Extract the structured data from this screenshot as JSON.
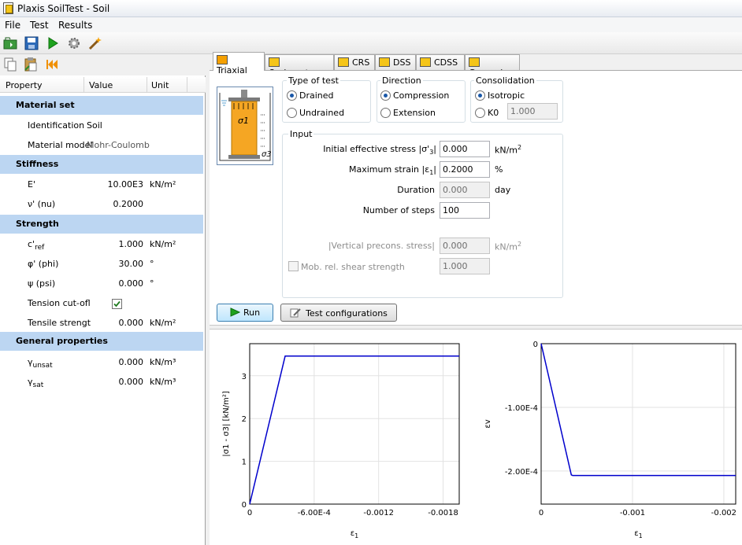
{
  "window": {
    "title": "Plaxis SoilTest - Soil"
  },
  "menu": [
    "File",
    "Test",
    "Results"
  ],
  "toolbar_icons": [
    "open-icon",
    "save-icon",
    "run-icon",
    "settings-icon",
    "wizard-icon"
  ],
  "left_toolbar_icons": [
    "copy-icon",
    "paste-icon",
    "rewind-icon"
  ],
  "properties": {
    "headers": {
      "property": "Property",
      "value": "Value",
      "unit": "Unit"
    },
    "material_set": {
      "title": "Material set",
      "identification": {
        "label": "Identification",
        "value": "Soil"
      },
      "material_model": {
        "label": "Material model",
        "value": "Mohr-Coulomb"
      }
    },
    "stiffness": {
      "title": "Stiffness",
      "E": {
        "label": "E'",
        "value": "10.00E3",
        "unit": "kN/m²"
      },
      "nu": {
        "label": "ν' (nu)",
        "value": "0.2000"
      }
    },
    "strength": {
      "title": "Strength",
      "c_ref": {
        "label_main": "c'",
        "label_sub": "ref",
        "value": "1.000",
        "unit": "kN/m²"
      },
      "phi": {
        "label": "φ' (phi)",
        "value": "30.00",
        "unit": "°"
      },
      "psi": {
        "label": "ψ (psi)",
        "value": "0.000",
        "unit": "°"
      },
      "tension_cutoff": {
        "label": "Tension cut-ofl",
        "checked": true
      },
      "tensile_strength": {
        "label": "Tensile strengt",
        "value": "0.000",
        "unit": "kN/m²"
      }
    },
    "general": {
      "title": "General properties",
      "gamma_unsat": {
        "label_main": "γ",
        "label_sub": "unsat",
        "value": "0.000",
        "unit": "kN/m³"
      },
      "gamma_sat": {
        "label_main": "γ",
        "label_sub": "sat",
        "value": "0.000",
        "unit": "kN/m³"
      }
    }
  },
  "tabs": [
    {
      "label": "Triaxial",
      "active": true
    },
    {
      "label": "Oedometer"
    },
    {
      "label": "CRS"
    },
    {
      "label": "DSS"
    },
    {
      "label": "CDSS"
    },
    {
      "label": "General"
    }
  ],
  "diagram": {
    "sigma1": "σ1",
    "sigma3": "σ3"
  },
  "type_of_test": {
    "title": "Type of test",
    "options": [
      "Drained",
      "Undrained"
    ],
    "selected": "Drained"
  },
  "direction": {
    "title": "Direction",
    "options": [
      "Compression",
      "Extension"
    ],
    "selected": "Compression"
  },
  "consolidation": {
    "title": "Consolidation",
    "options": [
      "Isotropic",
      "K0"
    ],
    "selected": "Isotropic",
    "k0_value": "1.000"
  },
  "input": {
    "title": "Input",
    "initial_stress": {
      "label_pre": "Initial effective stress |σ'",
      "label_sub": "3",
      "label_post": "|",
      "value": "0.000",
      "unit": "kN/m",
      "unit_sup": "2"
    },
    "max_strain": {
      "label_pre": "Maximum strain |ε",
      "label_sub": "1",
      "label_post": "|",
      "value": "0.2000",
      "unit": "%"
    },
    "duration": {
      "label": "Duration",
      "value": "0.000",
      "unit": "day"
    },
    "steps": {
      "label": "Number of steps",
      "value": "100"
    },
    "precons": {
      "label": "|Vertical precons. stress|",
      "value": "0.000",
      "unit": "kN/m",
      "unit_sup": "2"
    },
    "mob_shear": {
      "label": "Mob. rel. shear strength",
      "value": "1.000",
      "checked": false
    }
  },
  "buttons": {
    "run": "Run",
    "test_configurations": "Test configurations"
  },
  "chart_data": [
    {
      "type": "line",
      "ylabel": "|σ1 - σ3| [kN/m²]",
      "xlabel": "ε1",
      "x_ticks": [
        "0",
        "-6.00E-4",
        "-0.0012",
        "-0.0018"
      ],
      "y_ticks": [
        "0",
        "1",
        "2",
        "3"
      ],
      "xlim": [
        0,
        -0.00195
      ],
      "ylim": [
        0,
        3.75
      ],
      "grid": true,
      "series": [
        {
          "color": "#0000cc",
          "x": [
            0,
            -0.00033,
            -0.000345,
            -0.00195
          ],
          "y": [
            0,
            3.46,
            3.46,
            3.46
          ]
        }
      ]
    },
    {
      "type": "line",
      "ylabel": "εv",
      "xlabel": "ε1",
      "x_ticks": [
        "0",
        "-0.001",
        "-0.002"
      ],
      "y_ticks": [
        "0",
        "-1.00E-4",
        "-2.00E-4"
      ],
      "xlim": [
        0,
        -0.00213
      ],
      "ylim": [
        -0.000252,
        0
      ],
      "grid": true,
      "series": [
        {
          "color": "#0000cc",
          "x": [
            0,
            -0.00033,
            -0.000345,
            -0.00213
          ],
          "y": [
            0,
            -0.000206,
            -0.000207,
            -0.000207
          ]
        }
      ]
    }
  ]
}
